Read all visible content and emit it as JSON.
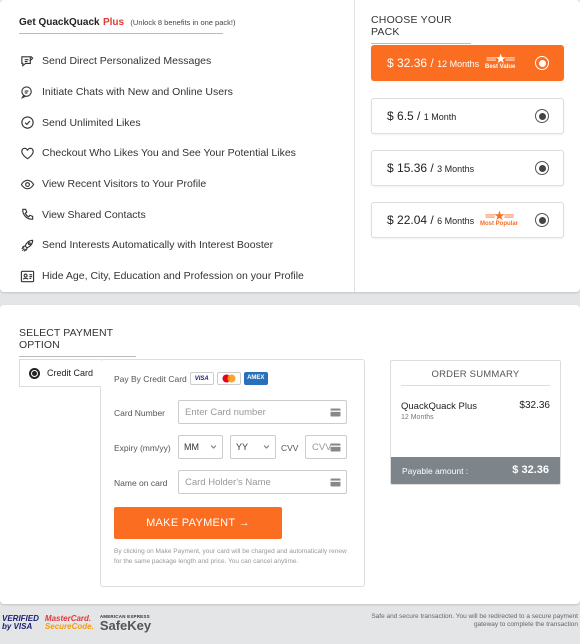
{
  "benefits": {
    "title_main": "Get QuackQuack",
    "title_plus": "Plus",
    "title_note": "(Unlock 8 benefits in one pack!)",
    "items": [
      {
        "icon": "message-edit-icon",
        "label": "Send Direct Personalized Messages"
      },
      {
        "icon": "chat-bubbles-icon",
        "label": "Initiate Chats with New and Online Users"
      },
      {
        "icon": "check-circle-icon",
        "label": "Send Unlimited Likes"
      },
      {
        "icon": "heart-icon",
        "label": "Checkout Who Likes You and See Your Potential Likes"
      },
      {
        "icon": "eye-icon",
        "label": "View Recent Visitors to Your Profile"
      },
      {
        "icon": "phone-icon",
        "label": "View Shared Contacts"
      },
      {
        "icon": "rocket-icon",
        "label": "Send Interests Automatically with Interest Booster"
      },
      {
        "icon": "id-card-icon",
        "label": "Hide Age, City, Education and Profession on your Profile"
      }
    ]
  },
  "packs": {
    "title": "CHOOSE YOUR PACK",
    "items": [
      {
        "currency": "$",
        "amount": "32.36",
        "duration": "12 Months",
        "tag": "Best Value",
        "selected": true
      },
      {
        "currency": "$",
        "amount": "6.5",
        "duration": "1 Month",
        "tag": "",
        "selected": false
      },
      {
        "currency": "$",
        "amount": "15.36",
        "duration": "3 Months",
        "tag": "",
        "selected": false
      },
      {
        "currency": "$",
        "amount": "22.04",
        "duration": "6 Months",
        "tag": "Most Popular",
        "selected": false
      }
    ]
  },
  "payment": {
    "title": "SELECT PAYMENT OPTION",
    "method_label": "Credit Card",
    "pay_by_label": "Pay By Credit Card",
    "card_brands": [
      "VISA",
      "MasterCard",
      "AMEX"
    ],
    "card_number_label": "Card Number",
    "card_number_placeholder": "Enter Card number",
    "expiry_label": "Expiry (mm/yy)",
    "month_value": "MM",
    "year_value": "YY",
    "cvv_label": "CVV",
    "cvv_placeholder": "CVV",
    "name_label": "Name on card",
    "name_placeholder": "Card Holder's Name",
    "button_label": "MAKE PAYMENT →",
    "disclaimer": "By clicking on Make Payment, your card will be charged and automatically renew for the same package length and price. You can cancel anytime."
  },
  "summary": {
    "title": "ORDER SUMMARY",
    "product": "QuackQuack Plus",
    "duration": "12 Months",
    "currency": "$",
    "price": "32.36",
    "payable_label": "Payable amount :",
    "payable_value": "32.36"
  },
  "footer": {
    "vbv_line1": "VERIFIED",
    "vbv_line2": "by VISA",
    "mc_line1": "MasterCard.",
    "mc_line2": "SecureCode.",
    "amex_small": "AMERICAN EXPRESS",
    "safekey": "SafeKey",
    "note": "Safe and secure transaction. You will be redirected to a secure payment gateway to complete the transaction"
  },
  "colors": {
    "accent": "#fb6d21",
    "plus_red": "#e53935",
    "summary_footer": "#7d848a"
  }
}
